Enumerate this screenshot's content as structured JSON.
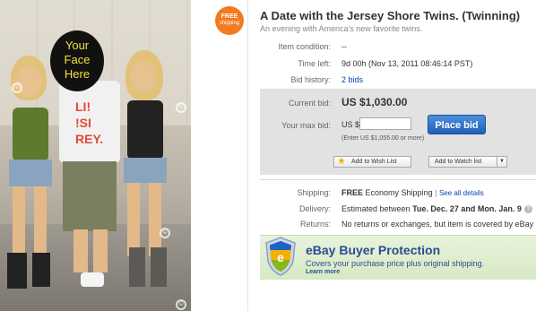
{
  "photo": {
    "overlay_text": [
      "Your",
      "Face",
      "Here"
    ],
    "shirt_text": "LI!\n!SI\nREY."
  },
  "badge": {
    "line1": "FREE",
    "line2": "shipping"
  },
  "listing": {
    "title": "A Date with the Jersey Shore Twins. (Twinning)",
    "subtitle": "An evening with America's new favorite twins."
  },
  "details": {
    "condition_label": "Item condition:",
    "condition_value": "--",
    "time_left_label": "Time left:",
    "time_left_value": "9d 00h (Nov 13, 2011 08:46:14 PST)",
    "bid_history_label": "Bid history:",
    "bid_history_value": "2 bids"
  },
  "bid": {
    "current_label": "Current bid:",
    "current_value": "US $1,030.00",
    "max_label": "Your max bid:",
    "currency": "US $",
    "input_value": "",
    "note": "(Enter US $1,055.00 or more)",
    "place_bid": "Place bid",
    "wish_list": "Add to Wish List",
    "watch_list": "Add to Watch list"
  },
  "shipping": {
    "shipping_label": "Shipping:",
    "shipping_free": "FREE",
    "shipping_method": "Economy Shipping",
    "see_all": "See all details",
    "delivery_label": "Delivery:",
    "delivery_prefix": "Estimated between",
    "delivery_dates": "Tue. Dec. 27 and Mon. Jan. 9",
    "returns_label": "Returns:",
    "returns_value": "No returns or exchanges, but item is covered by eBay"
  },
  "protection": {
    "title": "eBay Buyer Protection",
    "subtitle": "Covers your purchase price plus original shipping.",
    "learn_more": "Learn more"
  },
  "colors": {
    "badge": "#f47a20",
    "place_bid": "#2a6fc9",
    "link": "#0645ad",
    "protection_bg": "#dcebca"
  }
}
